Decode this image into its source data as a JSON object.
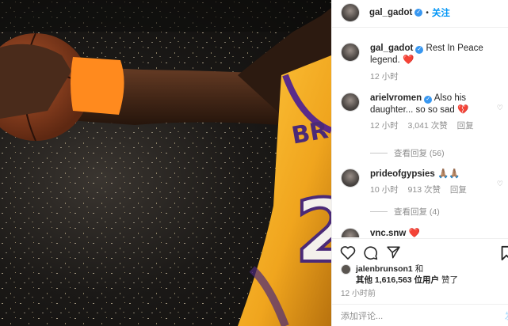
{
  "post": {
    "author": "gal_gadot",
    "follow_label": "关注",
    "dot": "•"
  },
  "photo": {
    "jersey_letters": "BR",
    "jersey_number": "2"
  },
  "caption": {
    "author": "gal_gadot",
    "text": "Rest In Peace legend.",
    "emoji": "❤️",
    "time": "12 小时"
  },
  "comments": [
    {
      "user": "arielvromen",
      "text": "Also his daughter... so so sad",
      "emoji": "💔",
      "time": "12 小时",
      "likes": "3,041 次赞",
      "reply": "回复",
      "view_replies": "查看回复 (56)"
    },
    {
      "user": "prideofgypsies",
      "text": "",
      "emoji": "🙏🏽🙏🏽",
      "time": "10 小时",
      "likes": "913 次赞",
      "reply": "回复",
      "view_replies": "查看回复 (4)"
    },
    {
      "user": "vnc.snw",
      "text": "",
      "emoji": "❤️"
    }
  ],
  "likes": {
    "first_user": "jalenbrunson1",
    "and": "和",
    "others": "其他 1,616,563 位用户",
    "suffix": "赞了"
  },
  "time_ago": "12 小时前",
  "add_comment": {
    "placeholder": "添加评论...",
    "post_label": "发"
  },
  "icons": {
    "verified": "✓",
    "heart_outline": "♡"
  },
  "colors": {
    "accent": "#0095f6",
    "verified": "#3897f0",
    "lakers_gold": "#f0b428",
    "wristband": "#ff8a1e"
  }
}
